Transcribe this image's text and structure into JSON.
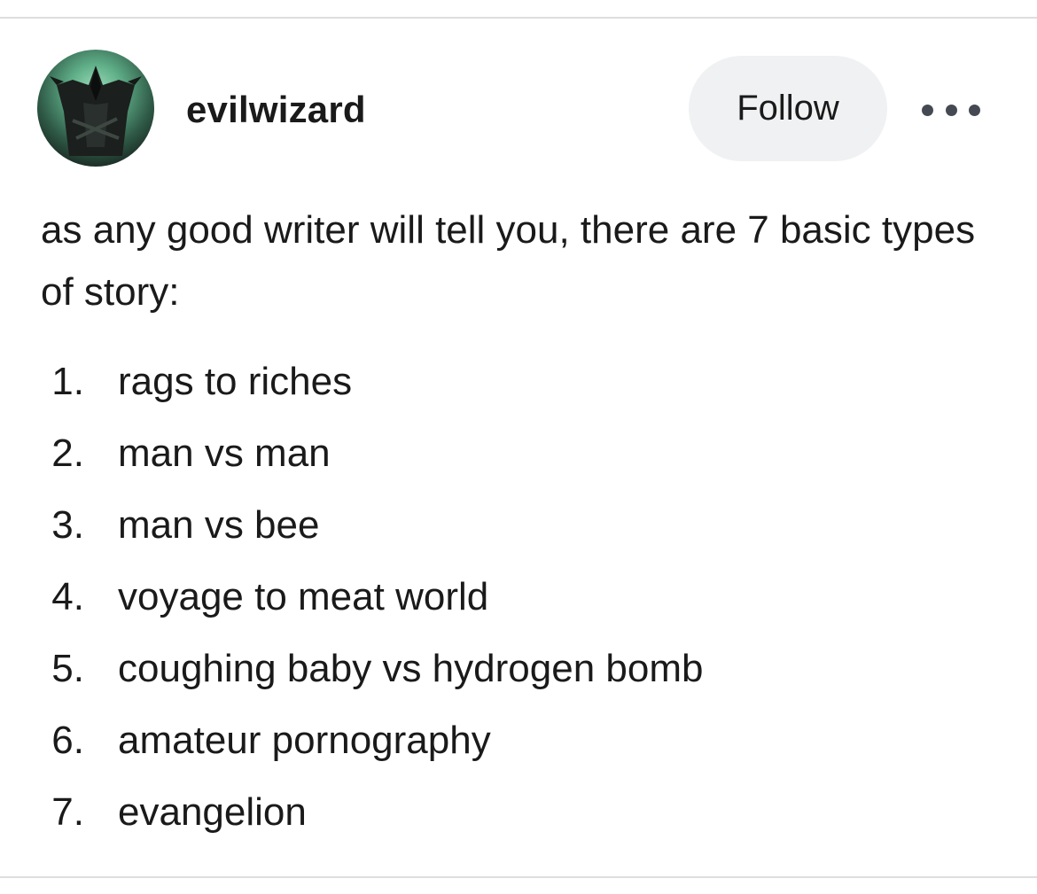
{
  "post": {
    "author": {
      "username": "evilwizard",
      "avatar_icon": "hooded-wizard-avatar"
    },
    "follow_label": "Follow",
    "more_icon": "more-options-icon",
    "intro": "as any good writer will tell you, there are 7 basic types of story:",
    "list": [
      {
        "number": "1.",
        "text": "rags to riches"
      },
      {
        "number": "2.",
        "text": "man vs man"
      },
      {
        "number": "3.",
        "text": "man vs bee"
      },
      {
        "number": "4.",
        "text": "voyage to meat world"
      },
      {
        "number": "5.",
        "text": "coughing baby vs hydrogen bomb"
      },
      {
        "number": "6.",
        "text": "amateur pornography"
      },
      {
        "number": "7.",
        "text": "evangelion"
      }
    ]
  },
  "colors": {
    "follow_bg": "#f0f1f2",
    "divider": "#dedede",
    "text": "#1a1a1a",
    "avatar_glow": "#6fc29a"
  }
}
